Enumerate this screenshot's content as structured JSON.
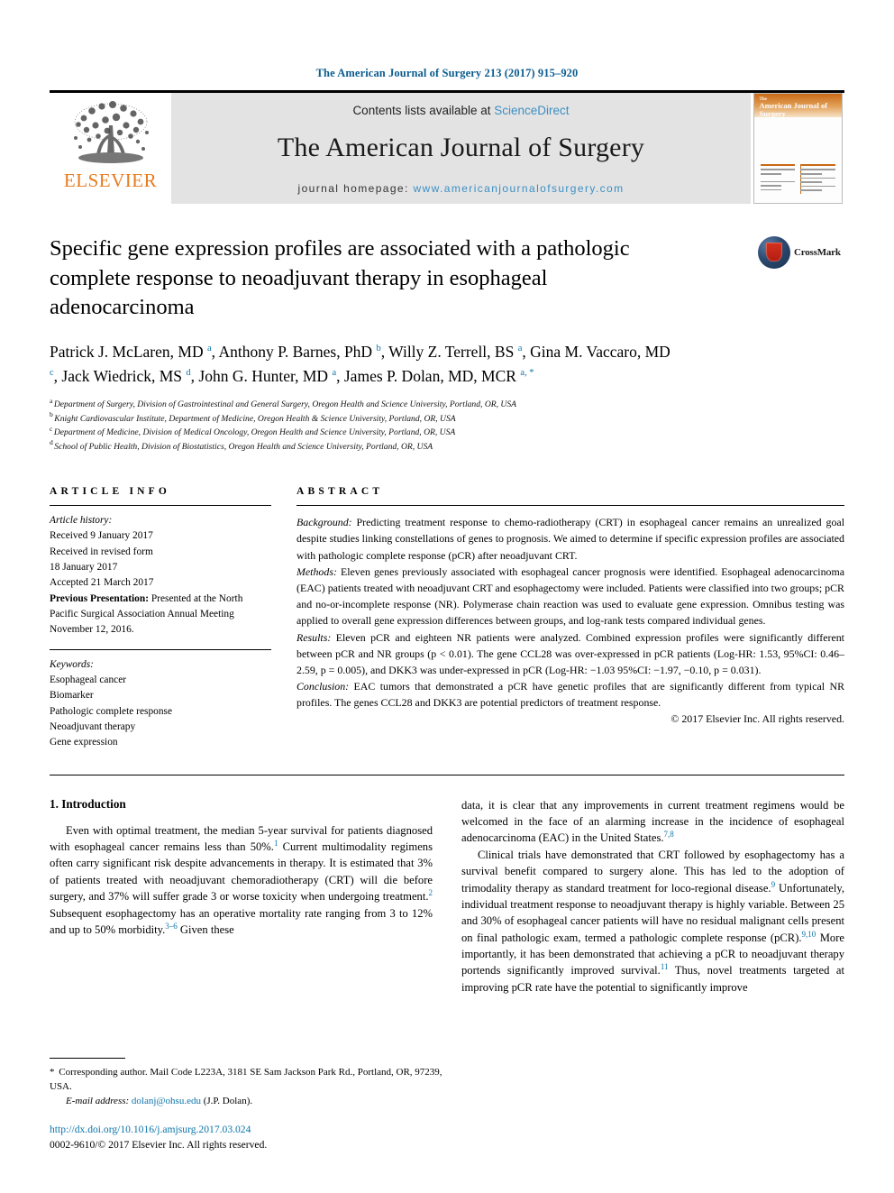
{
  "running_head": "The American Journal of Surgery 213 (2017) 915–920",
  "masthead": {
    "publisher_name": "ELSEVIER",
    "contents_prefix": "Contents lists available at ",
    "contents_link": "ScienceDirect",
    "journal_name": "The American Journal of Surgery",
    "homepage_prefix": "journal homepage: ",
    "homepage_url": "www.americanjournalofsurgery.com",
    "cover_the": "The",
    "cover_title": "American Journal of Surgery"
  },
  "crossmark": {
    "label": "CrossMark"
  },
  "article": {
    "title": "Specific gene expression profiles are associated with a pathologic complete response to neoadjuvant therapy in esophageal adenocarcinoma",
    "authors": [
      {
        "name": "Patrick J. McLaren, MD",
        "marks": "a",
        "sep": ", "
      },
      {
        "name": "Anthony P. Barnes, PhD",
        "marks": "b",
        "sep": ", "
      },
      {
        "name": "Willy Z. Terrell, BS",
        "marks": "a",
        "sep": ", "
      },
      {
        "name": "Gina M. Vaccaro, MD",
        "marks": "c",
        "sep": ", "
      },
      {
        "name": "Jack Wiedrick, MS",
        "marks": "d",
        "sep": ", "
      },
      {
        "name": "John G. Hunter, MD",
        "marks": "a",
        "sep": ", "
      },
      {
        "name": "James P. Dolan, MD, MCR",
        "marks": "a, *",
        "sep": ""
      }
    ],
    "affiliations": [
      {
        "mark": "a",
        "text": "Department of Surgery, Division of Gastrointestinal and General Surgery, Oregon Health and Science University, Portland, OR, USA"
      },
      {
        "mark": "b",
        "text": "Knight Cardiovascular Institute, Department of Medicine, Oregon Health & Science University, Portland, OR, USA"
      },
      {
        "mark": "c",
        "text": "Department of Medicine, Division of Medical Oncology, Oregon Health and Science University, Portland, OR, USA"
      },
      {
        "mark": "d",
        "text": "School of Public Health, Division of Biostatistics, Oregon Health and Science University, Portland, OR, USA"
      }
    ]
  },
  "article_info": {
    "heading": "ARTICLE INFO",
    "history_label": "Article history:",
    "history_lines": [
      "Received 9 January 2017",
      "Received in revised form",
      "18 January 2017",
      "Accepted 21 March 2017"
    ],
    "previous_presentation_label": "Previous Presentation:",
    "previous_presentation_text": " Presented at the North Pacific Surgical Association Annual Meeting November 12, 2016.",
    "keywords_label": "Keywords:",
    "keywords": [
      "Esophageal cancer",
      "Biomarker",
      "Pathologic complete response",
      "Neoadjuvant therapy",
      "Gene expression"
    ]
  },
  "abstract": {
    "heading": "ABSTRACT",
    "sections": [
      {
        "label": "Background:",
        "text": " Predicting treatment response to chemo-radiotherapy (CRT) in esophageal cancer remains an unrealized goal despite studies linking constellations of genes to prognosis. We aimed to determine if specific expression profiles are associated with pathologic complete response (pCR) after neoadjuvant CRT."
      },
      {
        "label": "Methods:",
        "text": " Eleven genes previously associated with esophageal cancer prognosis were identified. Esophageal adenocarcinoma (EAC) patients treated with neoadjuvant CRT and esophagectomy were included. Patients were classified into two groups; pCR and no-or-incomplete response (NR). Polymerase chain reaction was used to evaluate gene expression. Omnibus testing was applied to overall gene expression differences between groups, and log-rank tests compared individual genes."
      },
      {
        "label": "Results:",
        "text": " Eleven pCR and eighteen NR patients were analyzed. Combined expression profiles were significantly different between pCR and NR groups (p < 0.01). The gene CCL28 was over-expressed in pCR patients (Log-HR: 1.53, 95%CI: 0.46–2.59, p = 0.005), and DKK3 was under-expressed in pCR (Log-HR: −1.03 95%CI: −1.97, −0.10, p = 0.031)."
      },
      {
        "label": "Conclusion:",
        "text": " EAC tumors that demonstrated a pCR have genetic profiles that are significantly different from typical NR profiles. The genes CCL28 and DKK3 are potential predictors of treatment response."
      }
    ],
    "copyright": "© 2017 Elsevier Inc. All rights reserved."
  },
  "introduction": {
    "heading": "1. Introduction",
    "left_paragraph_parts": [
      {
        "text": "Even with optimal treatment, the median 5-year survival for patients diagnosed with esophageal cancer remains less than 50%."
      },
      {
        "ref": "1"
      },
      {
        "text": " Current multimodality regimens often carry significant risk despite advancements in therapy. It is estimated that 3% of patients treated with neoadjuvant chemoradiotherapy (CRT) will die before surgery, and 37% will suffer grade 3 or worse toxicity when undergoing treatment."
      },
      {
        "ref": "2"
      },
      {
        "text": " Subsequent esophagectomy has an operative mortality rate ranging from 3 to 12% and up to 50% morbidity."
      },
      {
        "ref": "3–6"
      },
      {
        "text": " Given these"
      }
    ],
    "right_paragraph_1_parts": [
      {
        "text": "data, it is clear that any improvements in current treatment regimens would be welcomed in the face of an alarming increase in the incidence of esophageal adenocarcinoma (EAC) in the United States."
      },
      {
        "ref": "7,8"
      }
    ],
    "right_paragraph_2_parts": [
      {
        "text": "Clinical trials have demonstrated that CRT followed by esophagectomy has a survival benefit compared to surgery alone. This has led to the adoption of trimodality therapy as standard treatment for loco-regional disease."
      },
      {
        "ref": "9"
      },
      {
        "text": " Unfortunately, individual treatment response to neoadjuvant therapy is highly variable. Between 25 and 30% of esophageal cancer patients will have no residual malignant cells present on final pathologic exam, termed a pathologic complete response (pCR)."
      },
      {
        "ref": "9,10"
      },
      {
        "text": " More importantly, it has been demonstrated that achieving a pCR to neoadjuvant therapy portends significantly improved survival."
      },
      {
        "ref": "11"
      },
      {
        "text": " Thus, novel treatments targeted at improving pCR rate have the potential to significantly improve"
      }
    ]
  },
  "footnote": {
    "star": "*",
    "corresponding": " Corresponding author. Mail Code L223A, 3181 SE Sam Jackson Park Rd., Portland, OR, 97239, USA.",
    "email_label": "E-mail address:",
    "email": "dolanj@ohsu.edu",
    "email_suffix": " (J.P. Dolan).",
    "doi": "http://dx.doi.org/10.1016/j.amjsurg.2017.03.024",
    "issn_line": "0002-9610/© 2017 Elsevier Inc. All rights reserved."
  },
  "colors": {
    "link": "#0b74aa",
    "elsevier_orange": "#e87b1e",
    "banner_gray": "#e3e3e3",
    "sciencedirect_blue": "#3d8fc4"
  }
}
